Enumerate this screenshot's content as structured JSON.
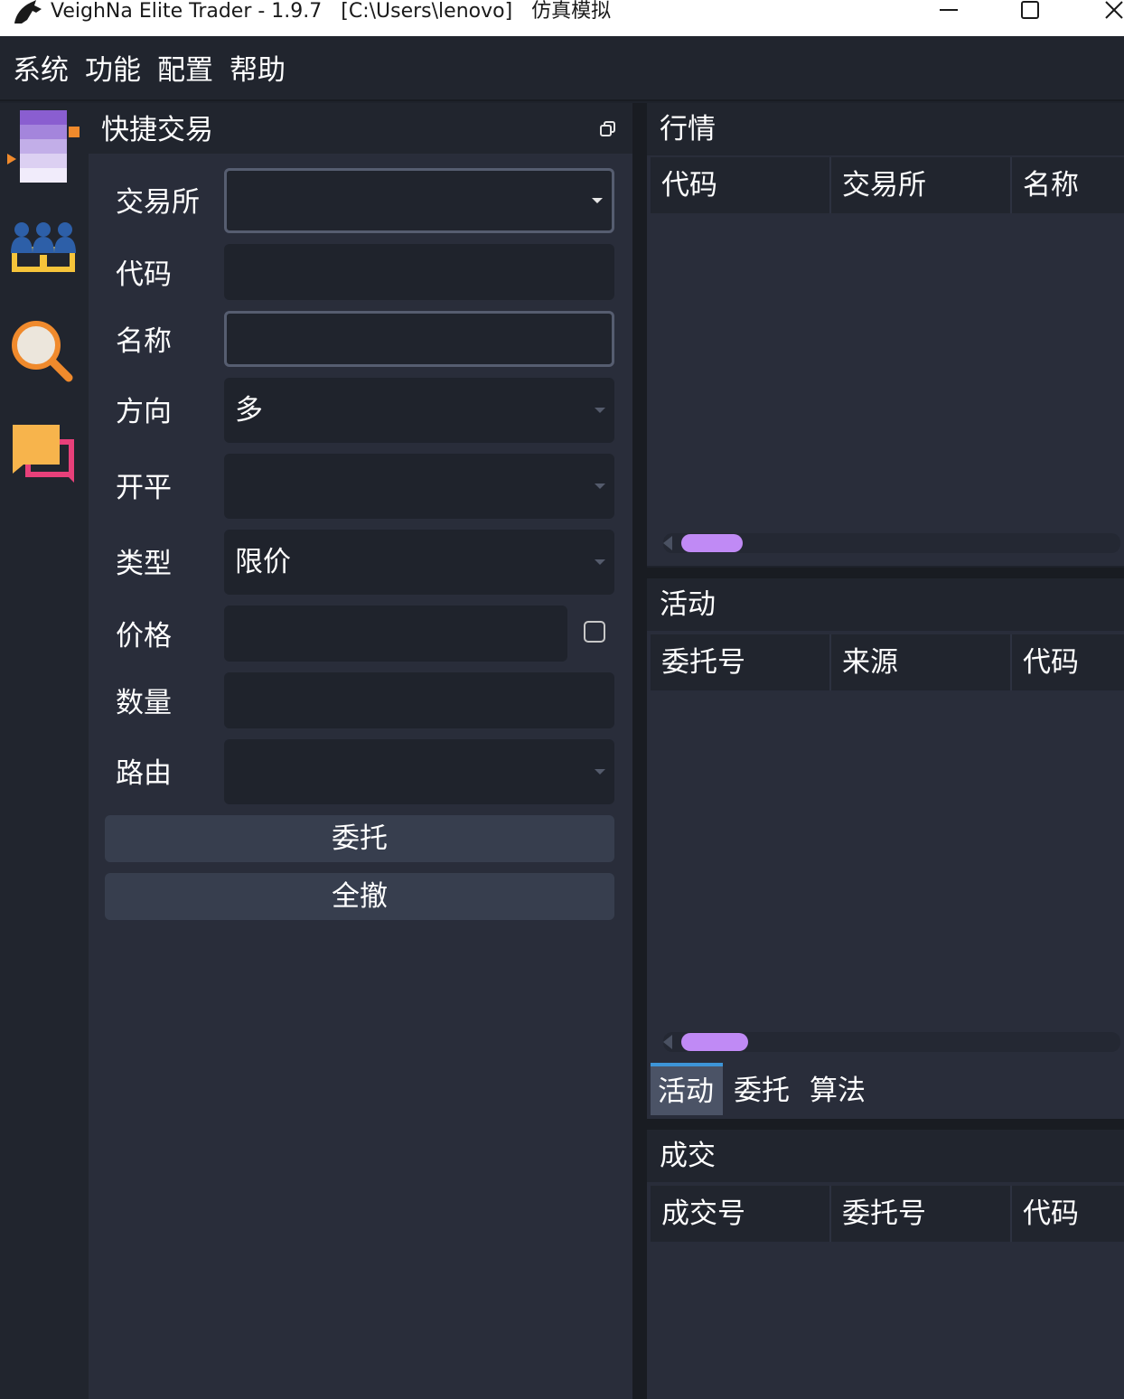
{
  "window": {
    "title": "VeighNa Elite Trader - 1.9.7   [C:\\Users\\lenovo]   仿真模拟",
    "controls": [
      "minimize",
      "maximize",
      "close"
    ]
  },
  "menubar": {
    "items": [
      "系统",
      "功能",
      "配置",
      "帮助"
    ]
  },
  "toolbar": {
    "tools": [
      "stack-app-icon",
      "team-app-icon",
      "search-app-icon",
      "chat-app-icon"
    ]
  },
  "quick_trade": {
    "title": "快捷交易",
    "fields": {
      "exchange": {
        "label": "交易所",
        "value": ""
      },
      "symbol": {
        "label": "代码",
        "value": ""
      },
      "name": {
        "label": "名称",
        "value": ""
      },
      "direction": {
        "label": "方向",
        "value": "多"
      },
      "offset": {
        "label": "开平",
        "value": ""
      },
      "type": {
        "label": "类型",
        "value": "限价"
      },
      "price": {
        "label": "价格",
        "value": "",
        "checked": false
      },
      "volume": {
        "label": "数量",
        "value": ""
      },
      "route": {
        "label": "路由",
        "value": ""
      }
    },
    "buttons": {
      "send": "委托",
      "cancel_all": "全撤"
    }
  },
  "market": {
    "title": "行情",
    "columns": [
      "代码",
      "交易所",
      "名称"
    ],
    "rows": []
  },
  "active": {
    "title": "活动",
    "columns": [
      "委托号",
      "来源",
      "代码"
    ],
    "rows": []
  },
  "tabs": {
    "items": [
      "活动",
      "委托",
      "算法"
    ],
    "selected": "活动"
  },
  "trades": {
    "title": "成交",
    "columns": [
      "成交号",
      "委托号",
      "代码"
    ],
    "rows": []
  },
  "colors": {
    "accent": "#c08af5",
    "tab_indicator": "#3d95d8",
    "background": "#292d3a"
  }
}
